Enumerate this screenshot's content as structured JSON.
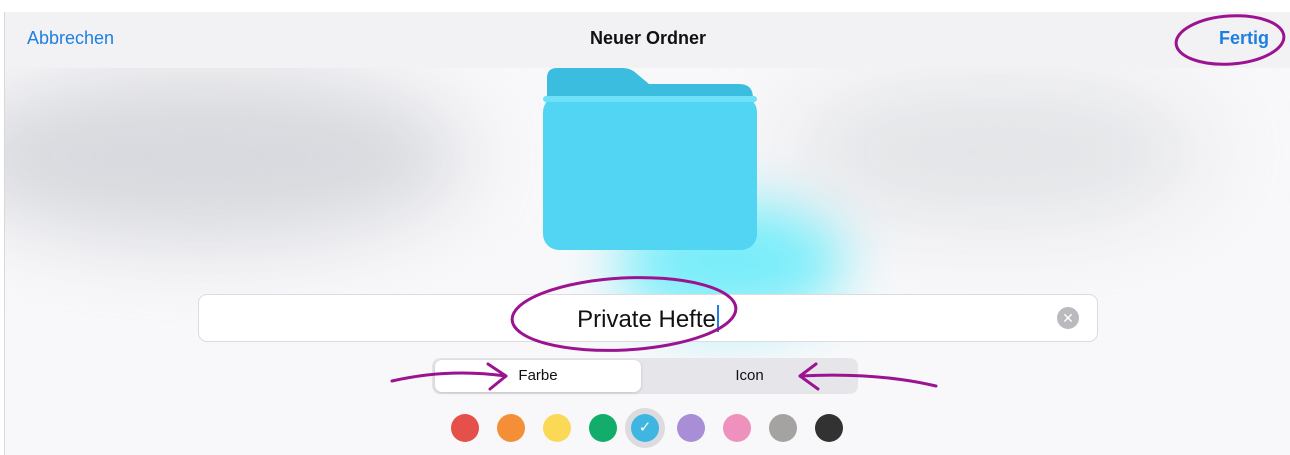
{
  "navbar": {
    "cancel_label": "Abbrechen",
    "title": "Neuer Ordner",
    "done_label": "Fertig"
  },
  "folder": {
    "icon": "folder-icon",
    "color": "#52d5f3"
  },
  "name_field": {
    "value": "Private Hefte",
    "clear_icon": "clear-icon"
  },
  "segmented_control": {
    "options": [
      "Farbe",
      "Icon"
    ],
    "selected": "Farbe"
  },
  "color_palette": {
    "colors": [
      "#e6504a",
      "#f48f38",
      "#fbd956",
      "#12ad6a",
      "#3fb6e2",
      "#a88ed6",
      "#ee91bd",
      "#a5a2a2",
      "#323232"
    ],
    "selected_index": 4,
    "selected_icon": "checkmark-icon"
  },
  "annotation_color": "#9c1392",
  "accent_color": "#1f7fe0"
}
